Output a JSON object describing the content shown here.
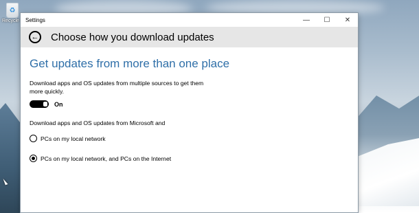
{
  "desktop": {
    "icon_label": "Recycle Bin"
  },
  "window": {
    "title": "Settings",
    "controls": {
      "minimize": "—",
      "maximize": "☐",
      "close": "✕"
    }
  },
  "header": {
    "back_glyph": "←",
    "title": "Choose how you download updates"
  },
  "main": {
    "section_title": "Get updates from more than one place",
    "description": "Download apps and OS updates from multiple sources to get them more quickly.",
    "toggle": {
      "state": "On",
      "enabled": true
    },
    "source_prompt": "Download apps and OS updates from Microsoft and",
    "options": [
      {
        "label": "PCs on my local network",
        "selected": false
      },
      {
        "label": "PCs on my local network, and PCs on the Internet",
        "selected": true
      }
    ]
  },
  "colors": {
    "accent": "#2f6fa8",
    "header_bg": "#e6e6e6"
  }
}
